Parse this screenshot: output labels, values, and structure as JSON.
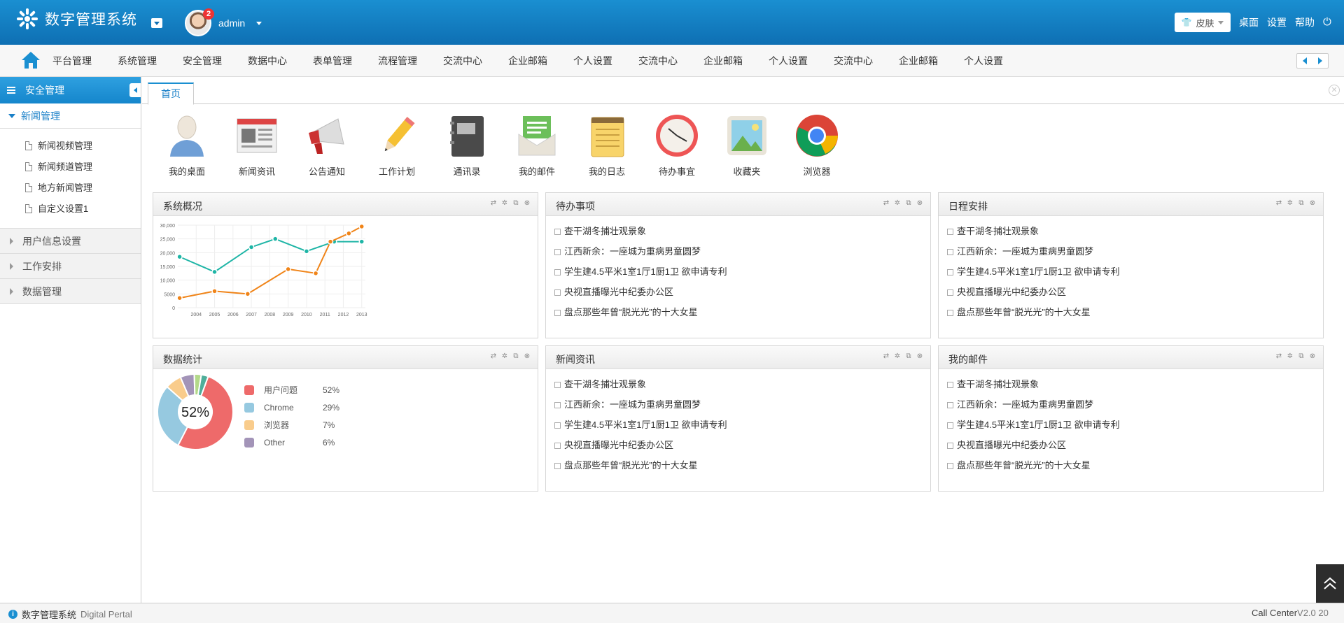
{
  "app": {
    "title": "数字管理系统",
    "user": "admin",
    "badge_count": "2"
  },
  "header": {
    "skin_label": "皮肤",
    "links": [
      "桌面",
      "设置",
      "帮助"
    ]
  },
  "topnav": {
    "items": [
      "平台管理",
      "系统管理",
      "安全管理",
      "数据中心",
      "表单管理",
      "流程管理",
      "交流中心",
      "企业邮箱",
      "个人设置",
      "交流中心",
      "企业邮箱",
      "个人设置",
      "交流中心",
      "企业邮箱",
      "个人设置"
    ]
  },
  "sidebar": {
    "title": "安全管理",
    "open_group": "新闻管理",
    "sub_items": [
      "新闻视频管理",
      "新闻频道管理",
      "地方新闻管理",
      "自定义设置1"
    ],
    "groups": [
      "用户信息设置",
      "工作安排",
      "数据管理"
    ]
  },
  "tabs": {
    "active": "首页"
  },
  "shortcuts": [
    {
      "label": "我的桌面",
      "icon": "user-desktop-icon"
    },
    {
      "label": "新闻资讯",
      "icon": "newspaper-icon"
    },
    {
      "label": "公告通知",
      "icon": "megaphone-icon"
    },
    {
      "label": "工作计划",
      "icon": "pencil-icon"
    },
    {
      "label": "通讯录",
      "icon": "address-book-icon"
    },
    {
      "label": "我的邮件",
      "icon": "mail-icon"
    },
    {
      "label": "我的日志",
      "icon": "notepad-icon"
    },
    {
      "label": "待办事宜",
      "icon": "clock-icon"
    },
    {
      "label": "收藏夹",
      "icon": "picture-icon"
    },
    {
      "label": "浏览器",
      "icon": "chrome-icon"
    }
  ],
  "panels": {
    "overview": {
      "title": "系统概况"
    },
    "todo": {
      "title": "待办事项",
      "items": [
        "查干湖冬捕壮观景象",
        "江西新余：一座城为重病男童圆梦",
        "学生建4.5平米1室1厅1厨1卫 欲申请专利",
        "央视直播曝光中纪委办公区",
        "盘点那些年曾“脱光光”的十大女星"
      ]
    },
    "schedule": {
      "title": "日程安排",
      "items": [
        "查干湖冬捕壮观景象",
        "江西新余：一座城为重病男童圆梦",
        "学生建4.5平米1室1厅1厨1卫 欲申请专利",
        "央视直播曝光中纪委办公区",
        "盘点那些年曾“脱光光”的十大女星"
      ]
    },
    "stats": {
      "title": "数据统计",
      "center_label": "52%"
    },
    "news": {
      "title": "新闻资讯",
      "items": [
        "查干湖冬捕壮观景象",
        "江西新余：一座城为重病男童圆梦",
        "学生建4.5平米1室1厅1厨1卫 欲申请专利",
        "央视直播曝光中纪委办公区",
        "盘点那些年曾“脱光光”的十大女星"
      ]
    },
    "mail": {
      "title": "我的邮件",
      "items": [
        "查干湖冬捕壮观景象",
        "江西新余：一座城为重病男童圆梦",
        "学生建4.5平米1室1厅1厨1卫 欲申请专利",
        "央视直播曝光中纪委办公区",
        "盘点那些年曾“脱光光”的十大女星"
      ]
    }
  },
  "chart_data": [
    {
      "type": "line",
      "x": [
        "2004",
        "2005",
        "2006",
        "2007",
        "2008",
        "2009",
        "2010",
        "2011",
        "2012",
        "2013"
      ],
      "yticks": [
        "0",
        "5000",
        "10,000",
        "15,000",
        "20,000",
        "25,000",
        "30,000"
      ],
      "ylim": [
        0,
        30000
      ],
      "grid": true,
      "series": [
        {
          "color": "#1eb5a6",
          "x": [
            2003.1,
            2005,
            2007,
            2008.3,
            2010,
            2011.5,
            2013
          ],
          "values": [
            18500,
            13000,
            22000,
            25000,
            20500,
            24000,
            24000
          ]
        },
        {
          "color": "#f08418",
          "x": [
            2003.1,
            2005,
            2006.8,
            2009,
            2010.5,
            2011.3,
            2012.3,
            2013
          ],
          "values": [
            3500,
            6000,
            5000,
            14000,
            12500,
            24000,
            27000,
            29500
          ]
        }
      ]
    },
    {
      "type": "pie",
      "labels": [
        "用户问题",
        "Chrome",
        "浏览器",
        "Other"
      ],
      "values": [
        52,
        29,
        7,
        6
      ],
      "display": [
        "52%",
        "29%",
        "7%",
        "6%"
      ],
      "colors": [
        "#ee6a6a",
        "#96c9e0",
        "#f9cc8c",
        "#a394b8"
      ],
      "extra_slices_colors": [
        "#b3d98a",
        "#4fae9a"
      ]
    }
  ],
  "footer": {
    "left_cn": "数字管理系统",
    "left_en": "Digital Pertal",
    "right": "Call Center",
    "version": "V2.0 20"
  }
}
